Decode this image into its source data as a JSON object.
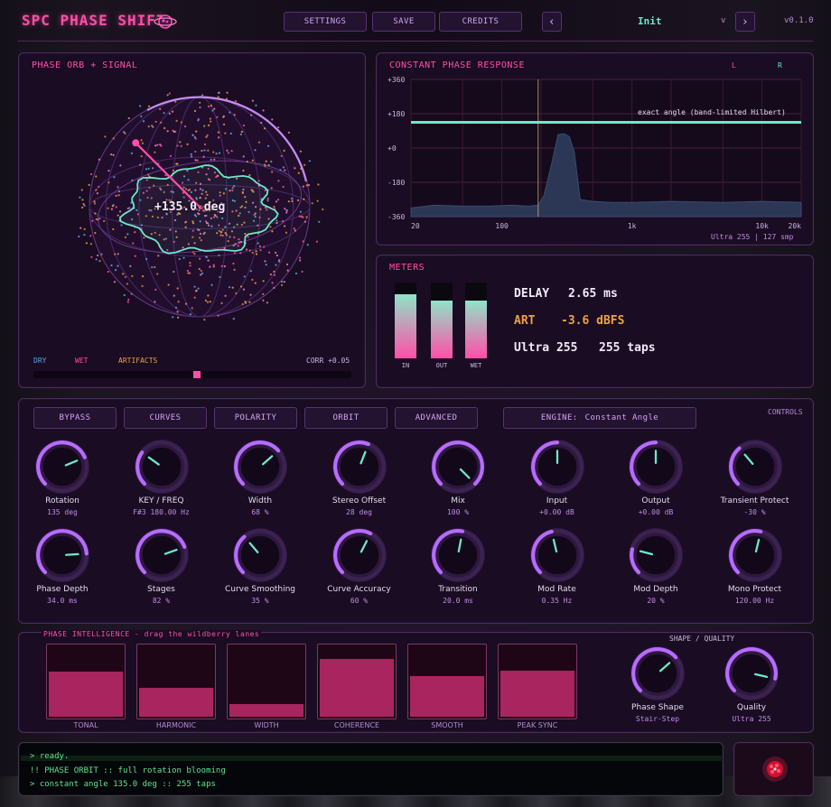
{
  "app": {
    "title": "SPC PHASE SHIFT",
    "version": "v0.1.0"
  },
  "topbar": {
    "settings": "SETTINGS",
    "save": "SAVE",
    "credits": "CREDITS",
    "prev": "‹",
    "next": "›",
    "preset": "Init",
    "preset_arrow": "v"
  },
  "orb": {
    "title": "PHASE ORB + SIGNAL",
    "readout": "+135.0 deg",
    "legend_dry": "DRY",
    "legend_wet": "WET",
    "legend_artifacts": "ARTIFACTS",
    "corr": "CORR +0.05",
    "slider_position": 0.515
  },
  "response": {
    "title": "CONSTANT PHASE RESPONSE",
    "chan_l": "L",
    "chan_r": "R",
    "annotation": "exact angle (band-limited Hilbert)",
    "footer": "Ultra 255 | 127 smp",
    "chart_data": {
      "type": "line",
      "x_scale": "log",
      "y_ticks": [
        "+360",
        "+180",
        "+0",
        "-180",
        "-360"
      ],
      "x_ticks": [
        "20",
        "100",
        "1k",
        "10k",
        "20k"
      ],
      "xlim": [
        20,
        20000
      ],
      "ylim": [
        -360,
        360
      ],
      "series": [
        {
          "values": [
            135,
            135
          ]
        }
      ],
      "spectrum_freq": [
        20,
        30,
        50,
        80,
        120,
        160,
        190,
        210,
        240,
        270,
        300,
        330,
        360,
        400,
        500,
        700,
        1000,
        2000,
        5000,
        10000,
        20000
      ],
      "spectrum_db": [
        -315,
        -300,
        -305,
        -305,
        -300,
        -305,
        -300,
        -250,
        -90,
        70,
        75,
        60,
        -20,
        -270,
        -280,
        -285,
        -285,
        -280,
        -285,
        -280,
        -285
      ],
      "marker_freq": 190
    }
  },
  "meters": {
    "title": "METERS",
    "in_label": "IN",
    "out_label": "OUT",
    "wet_label": "WET",
    "in_level": 0.85,
    "out_level": 0.76,
    "wet_level": 0.76,
    "delay_label": "DELAY",
    "delay_value": "2.65 ms",
    "art_label": "ART",
    "art_value": "-3.6 dBFS",
    "quality_label": "Ultra 255",
    "taps_value": "255 taps"
  },
  "controls": {
    "title": "CONTROLS",
    "buttons": {
      "bypass": "BYPASS",
      "curves": "CURVES",
      "polarity": "POLARITY",
      "orbit": "ORBIT",
      "advanced": "ADVANCED"
    },
    "engine_label": "ENGINE:",
    "engine_value": "Constant Angle",
    "knobs": [
      {
        "label": "Rotation",
        "value": "135 deg",
        "level": 0.75
      },
      {
        "label": "KEY / FREQ",
        "value": "F#3  180.00 Hz",
        "level": 0.3
      },
      {
        "label": "Width",
        "value": "68 %",
        "level": 0.68
      },
      {
        "label": "Stereo Offset",
        "value": "28 deg",
        "level": 0.58
      },
      {
        "label": "Mix",
        "value": "100 %",
        "level": 1.0
      },
      {
        "label": "Input",
        "value": "+0.00 dB",
        "level": 0.5
      },
      {
        "label": "Output",
        "value": "+0.00 dB",
        "level": 0.5
      },
      {
        "label": "Transient Protect",
        "value": "-30 %",
        "level": 0.35
      },
      {
        "label": "Phase Depth",
        "value": "34.0 ms",
        "level": 0.82
      },
      {
        "label": "Stages",
        "value": "82 %",
        "level": 0.76
      },
      {
        "label": "Curve Smoothing",
        "value": "35 %",
        "level": 0.35
      },
      {
        "label": "Curve Accuracy",
        "value": "60 %",
        "level": 0.6
      },
      {
        "label": "Transition",
        "value": "20.0 ms",
        "level": 0.54
      },
      {
        "label": "Mod Rate",
        "value": "0.35 Hz",
        "level": 0.45
      },
      {
        "label": "Mod Depth",
        "value": "20 %",
        "level": 0.22
      },
      {
        "label": "Mono Protect",
        "value": "120.00 Hz",
        "level": 0.55
      }
    ]
  },
  "intelligence": {
    "title": "PHASE INTELLIGENCE - drag the wildberry lanes",
    "lanes": [
      {
        "label": "TONAL",
        "level": 0.62
      },
      {
        "label": "HARMONIC",
        "level": 0.4
      },
      {
        "label": "WIDTH",
        "level": 0.18
      },
      {
        "label": "COHERENCE",
        "level": 0.8
      },
      {
        "label": "SMOOTH",
        "level": 0.56
      },
      {
        "label": "PEAK SYNC",
        "level": 0.64
      }
    ],
    "shape_quality_title": "SHAPE / QUALITY",
    "shape_label": "Phase Shape",
    "shape_value": "Stair-Step",
    "shape_level": 0.68,
    "quality_label": "Quality",
    "quality_value": "Ultra 255",
    "quality_level": 0.88
  },
  "console": {
    "line1": "> ready.",
    "line2": "!! PHASE ORBIT :: full rotation blooming",
    "line3": "> constant angle 135.0 deg :: 255 taps"
  },
  "colors": {
    "accent": "#ff4fa8",
    "mint": "#6ee8c8",
    "purple": "#b66cff",
    "orange": "#f0a040"
  }
}
